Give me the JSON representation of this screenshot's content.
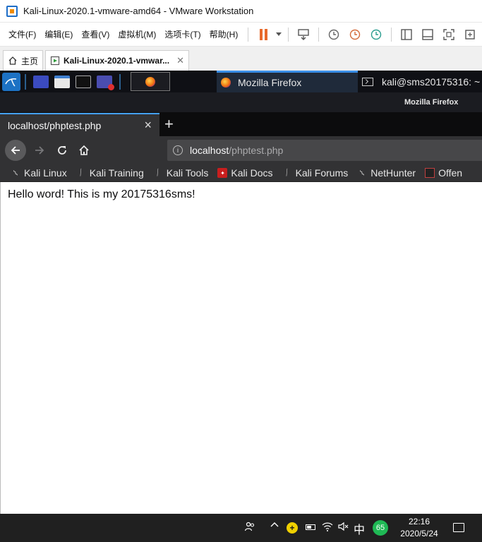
{
  "vmware": {
    "window_title": "Kali-Linux-2020.1-vmware-amd64 - VMware Workstation",
    "menu": [
      "文件(F)",
      "编辑(E)",
      "查看(V)",
      "虚拟机(M)",
      "选项卡(T)",
      "帮助(H)"
    ],
    "tabs": [
      {
        "label": "主页",
        "icon": "home-icon"
      },
      {
        "label": "Kali-Linux-2020.1-vmwar...",
        "icon": "vm-icon"
      }
    ]
  },
  "kali_panel": {
    "tasks": [
      {
        "label": "Mozilla Firefox",
        "icon": "firefox-icon"
      },
      {
        "label": "kali@sms20175316: ~",
        "icon": "terminal-icon"
      }
    ]
  },
  "firefox": {
    "window_title": "Mozilla Firefox",
    "tab": {
      "label": "localhost/phptest.php"
    },
    "new_tab_label": "+",
    "url": {
      "host": "localhost",
      "path": "/phptest.php"
    },
    "bookmarks": [
      {
        "label": "Kali Linux",
        "icon": "kali-icon"
      },
      {
        "label": "Kali Training",
        "icon": "kali-dragon-icon"
      },
      {
        "label": "Kali Tools",
        "icon": "kali-dragon-icon"
      },
      {
        "label": "Kali Docs",
        "icon": "docs-icon"
      },
      {
        "label": "Kali Forums",
        "icon": "kali-dragon-icon"
      },
      {
        "label": "NetHunter",
        "icon": "nethunter-icon"
      },
      {
        "label": "Offen",
        "icon": "offsec-icon"
      }
    ]
  },
  "page": {
    "content_text": "Hello word! This is my 20175316sms!"
  },
  "taskbar": {
    "ime": "中",
    "badge": "65",
    "time": "22:16",
    "date": "2020/5/24"
  },
  "colors": {
    "accent": "#45a1ff",
    "pause": "#e8692a",
    "badge": "#1fb955"
  }
}
